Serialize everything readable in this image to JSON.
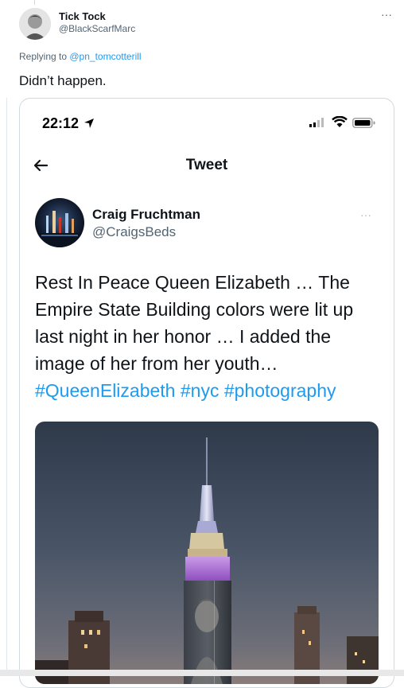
{
  "reply": {
    "author_name": "Tick Tock",
    "author_handle": "@BlackScarfMarc",
    "replying_prefix": "Replying to ",
    "replying_to": "@pn_tomcotterill",
    "text": "Didn’t happen.",
    "more": "···"
  },
  "screenshot": {
    "status_time": "22:12",
    "nav_title": "Tweet",
    "author_name": "Craig Fruchtman",
    "author_handle": "@CraigsBeds",
    "more": "···",
    "text": "Rest In Peace Queen Elizabeth … The Empire State Building colors were lit up last night in her honor … I added the image of her from her youth…",
    "hashtags": "#QueenElizabeth #nyc #photography"
  }
}
